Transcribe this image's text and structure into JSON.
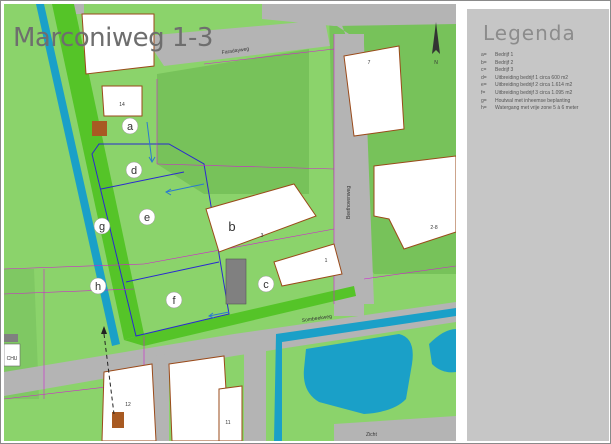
{
  "title": "Marconiweg 1-3",
  "legend": {
    "title": "Legenda",
    "items": [
      {
        "key": "a=",
        "text": "Bedrijf 1"
      },
      {
        "key": "b=",
        "text": "Bedrijf 2"
      },
      {
        "key": "c=",
        "text": "Bedrijf 3"
      },
      {
        "key": "d=",
        "text": "Uitbreiding bedrijf 1 circa 600 m2"
      },
      {
        "key": "e=",
        "text": "Uitbreiding bedrijf 2 circa 1.614 m2"
      },
      {
        "key": "f=",
        "text": "Uitbreiding bedrijf 3 circa 1.095 m2"
      },
      {
        "key": "g=",
        "text": "Houtwal met inheemse beplanting"
      },
      {
        "key": "h=",
        "text": "Watergang met vrije zone 5 à 6 meter"
      }
    ]
  },
  "zones": [
    "a",
    "b",
    "c",
    "d",
    "e",
    "f",
    "g",
    "h"
  ],
  "streets": {
    "faradayweg": "Faradayweg",
    "beethovenweg": "Beethovenweg",
    "zonnebloemweg": "Sombeekweg",
    "zicht": "Zicht"
  },
  "house_numbers": {
    "n14": "14",
    "n3": "3",
    "n1": "1",
    "n7": "7",
    "n2_8": "2-8",
    "n12": "12",
    "n11": "11"
  },
  "edge_label": "CHU",
  "north_label": "N",
  "colors": {
    "grass": "#8bd36b",
    "grass_dark": "#77c25a",
    "road": "#b4b4b4",
    "water": "#1aa0c8",
    "hedge": "#55c428",
    "building_outline": "#9a4a1a",
    "parcel_line": "#d020d0",
    "plan_line": "#2a2ad0"
  }
}
